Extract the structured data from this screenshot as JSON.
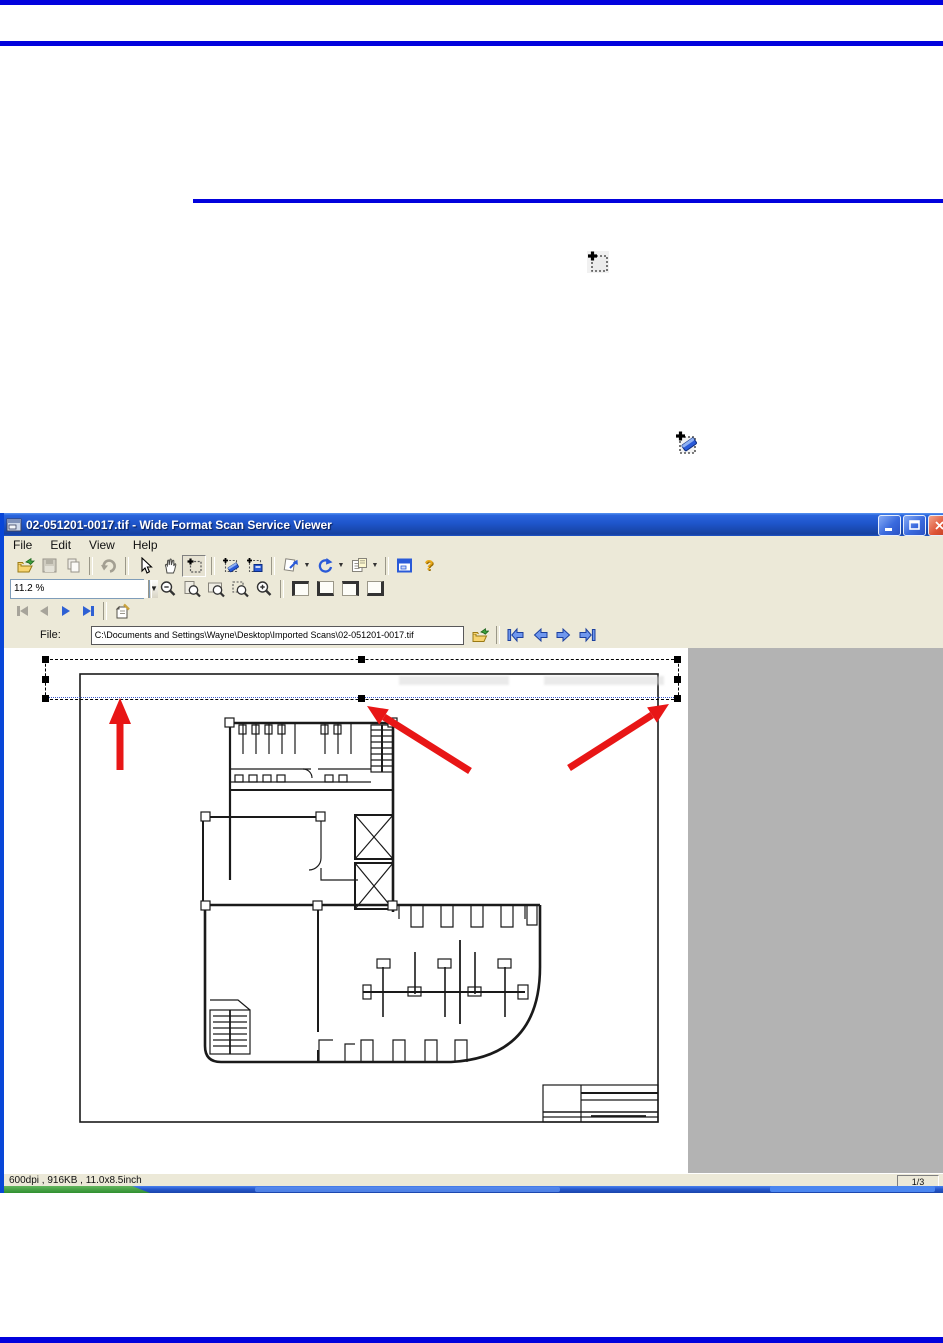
{
  "document": {
    "rule_color": "#0202dd",
    "inline_icons": {
      "select_area_tool": "dashed-selection-square-with-plus",
      "erase_area_tool": "dashed-selection-square-with-blue-eraser"
    }
  },
  "app": {
    "title": "02-051201-0017.tif - Wide Format Scan Service Viewer",
    "window_buttons": [
      "minimize",
      "maximize",
      "close"
    ],
    "menu": {
      "file": "File",
      "edit": "Edit",
      "view": "View",
      "help": "Help"
    },
    "toolbar": {
      "zoom_value": "11.2 %",
      "icons_main": [
        "open",
        "save",
        "copy",
        "undo",
        "pointer",
        "pan-hand",
        "select-area",
        "erase-area",
        "crop-area",
        "deskew",
        "rotate",
        "page-setup",
        "viewer-window",
        "help"
      ],
      "icons_zoom": [
        "zoom-out",
        "zoom-page",
        "zoom-width",
        "zoom-selection",
        "zoom-in"
      ],
      "icons_corner": [
        "view-top-left",
        "view-bottom-left",
        "view-top-right",
        "view-bottom-right"
      ],
      "icons_nav": [
        "first-page",
        "previous-page",
        "next-page",
        "last-page",
        "page-properties"
      ]
    },
    "filebar": {
      "label": "File:",
      "path": "C:\\Documents and Settings\\Wayne\\Desktop\\Imported Scans\\02-051201-0017.tif",
      "icons": [
        "browse-folder",
        "go-first",
        "go-previous",
        "go-next",
        "go-last"
      ]
    },
    "statusbar": {
      "info": "600dpi , 916KB , 11.0x8.5inch",
      "page_indicator": "1/3"
    }
  }
}
